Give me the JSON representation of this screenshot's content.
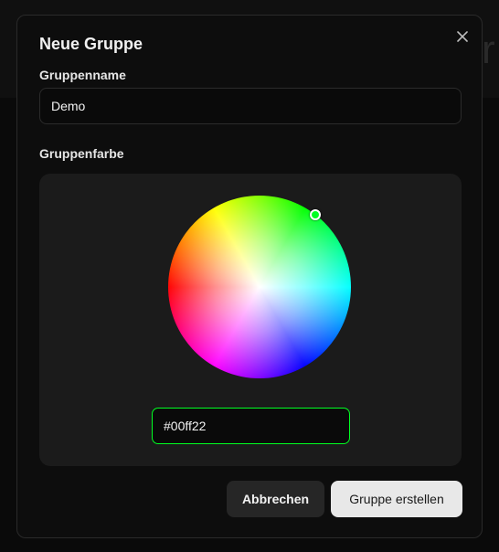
{
  "dialog": {
    "title": "Neue Gruppe",
    "close_icon": "close-icon"
  },
  "fields": {
    "name_label": "Gruppenname",
    "name_value": "Demo",
    "color_label": "Gruppenfarbe",
    "hex_value": "#00ff22"
  },
  "colors": {
    "selected": "#00ff22",
    "dialog_bg": "#0d0d0d",
    "panel_bg": "#1b1b1b"
  },
  "buttons": {
    "cancel_label": "Abbrechen",
    "create_label": "Gruppe erstellen"
  }
}
